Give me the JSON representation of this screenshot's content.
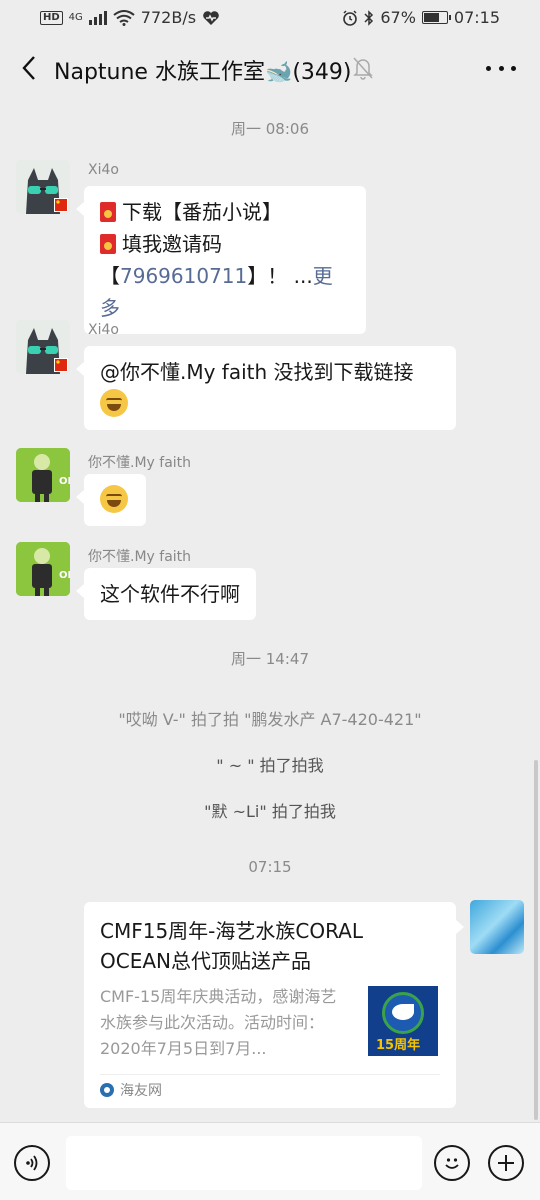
{
  "status_bar": {
    "network_badge": "HD",
    "network_type": "4G",
    "speed": "772B/s",
    "battery": "67%",
    "battery_level": 0.67,
    "time": "07:15"
  },
  "header": {
    "title": "Naptune 水族工作室🐋(349)"
  },
  "messages": [
    {
      "type": "time",
      "text": "周一 08:06"
    },
    {
      "type": "text",
      "sender": "Xi4o",
      "line1": "下载【番茄小说】",
      "line2": "填我邀请码",
      "line3_prefix": "【",
      "line3_code": "7969610711",
      "line3_suffix": "】！ ...",
      "more": "更多"
    },
    {
      "type": "text",
      "sender": "Xi4o",
      "text": "@你不懂.My faith  没找到下载链接"
    },
    {
      "type": "emoji",
      "sender": "你不懂.My faith"
    },
    {
      "type": "text",
      "sender": "你不懂.My faith",
      "text": "这个软件不行啊"
    },
    {
      "type": "time",
      "text": "周一 14:47"
    },
    {
      "type": "system",
      "text": "\"哎呦 V-\" 拍了拍 \"鹏发水产 A7-420-421\""
    },
    {
      "type": "system",
      "text": "\" ~ \" 拍了拍我"
    },
    {
      "type": "system",
      "text": "\"默 ~Li\" 拍了拍我"
    },
    {
      "type": "time",
      "text": "07:15"
    },
    {
      "type": "link_card",
      "title": "CMF15周年-海艺水族CORAL OCEAN总代顶贴送产品",
      "description": "CMF-15周年庆典活动，感谢海艺水族参与此次活动。活动时间：2020年7月5日到7月...",
      "thumb_badge": "15周年",
      "source": "海友网"
    }
  ]
}
